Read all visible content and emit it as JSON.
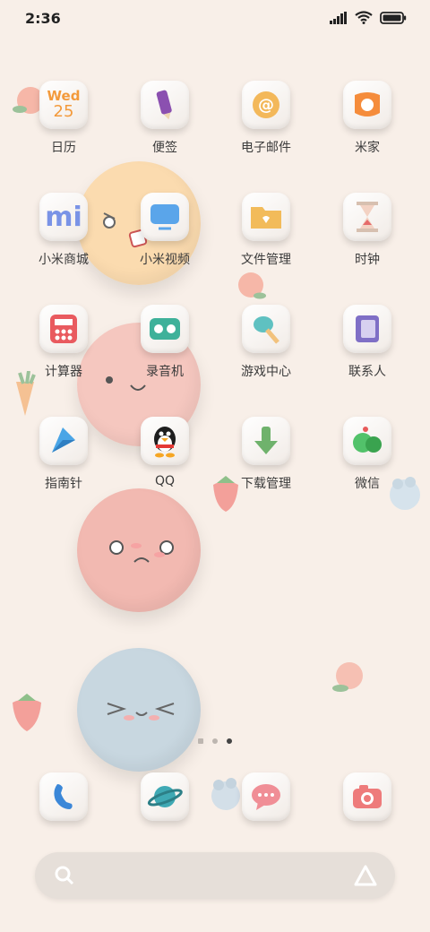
{
  "status": {
    "time": "2:36"
  },
  "apps": [
    {
      "label": "日历",
      "calendar_day": "Wed",
      "calendar_date": "25"
    },
    {
      "label": "便签"
    },
    {
      "label": "电子邮件"
    },
    {
      "label": "米家"
    },
    {
      "label": "小米商城",
      "logo_text": "mi"
    },
    {
      "label": "小米视频"
    },
    {
      "label": "文件管理"
    },
    {
      "label": "时钟"
    },
    {
      "label": "计算器"
    },
    {
      "label": "录音机"
    },
    {
      "label": "游戏中心"
    },
    {
      "label": "联系人"
    },
    {
      "label": "指南针"
    },
    {
      "label": "QQ"
    },
    {
      "label": "下载管理"
    },
    {
      "label": "微信"
    }
  ],
  "dock": [
    {
      "name": "phone"
    },
    {
      "name": "browser"
    },
    {
      "name": "messages"
    },
    {
      "name": "camera"
    }
  ],
  "search": {
    "placeholder": ""
  }
}
